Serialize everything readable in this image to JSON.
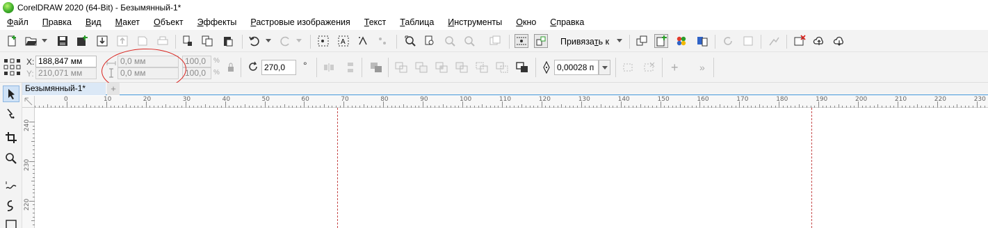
{
  "window": {
    "title": "CorelDRAW 2020 (64-Bit) - Безымянный-1*"
  },
  "menu": [
    {
      "u": "Ф",
      "rest": "айл"
    },
    {
      "u": "П",
      "rest": "равка"
    },
    {
      "u": "В",
      "rest": "ид"
    },
    {
      "u": "М",
      "rest": "акет"
    },
    {
      "u": "О",
      "rest": "бъект"
    },
    {
      "u": "Э",
      "rest": "ффекты"
    },
    {
      "u": "Р",
      "rest": "астровые изображения"
    },
    {
      "u": "Т",
      "rest": "екст"
    },
    {
      "u": "Т",
      "rest": "аблица"
    },
    {
      "u": "И",
      "rest": "нструменты"
    },
    {
      "u": "О",
      "rest": "кно"
    },
    {
      "u": "С",
      "rest": "правка"
    }
  ],
  "toolbar": {
    "snap_label_pre": "Привяза",
    "snap_label_u": "т",
    "snap_label_post": "ь к",
    "icons": [
      "new-document-icon",
      "open-folder-icon",
      "save-icon",
      "new-from-template-icon",
      "import-icon",
      "export-icon",
      "publish-pdf-icon",
      "print-icon",
      "cut-icon",
      "copy-icon",
      "paste-icon",
      "undo-icon",
      "redo-icon",
      "search-content-icon",
      "quick-text-icon",
      "spell-icon",
      "zoom-to-fit-icon",
      "zoom-level-icon",
      "full-screen-icon",
      "show-rulers-icon",
      "show-grid-icon",
      "snap-icon",
      "options-icon",
      "colors-icon",
      "document-properties-icon",
      "launch-icon",
      "upload-cloud-icon",
      "download-cloud-icon"
    ]
  },
  "propbar": {
    "x_label": "X:",
    "y_label": "Y:",
    "x_value": "188,847 мм",
    "y_value": "210,071 мм",
    "width_value": "0,0 мм",
    "height_value": "0,0 мм",
    "scale_x": "100,0",
    "scale_y": "100,0",
    "scale_unit": "%",
    "rotation_value": "270,0",
    "rotation_unit": "°",
    "outline_value": "0,00028 п"
  },
  "document": {
    "tab_label": "Безымянный-1*",
    "add_tab_label": "+"
  },
  "ruler": {
    "h_labels": [
      "0",
      "10",
      "20",
      "30",
      "40",
      "50",
      "60",
      "70",
      "80",
      "90",
      "100",
      "110",
      "120",
      "130",
      "140",
      "150",
      "160",
      "170",
      "180",
      "190",
      "200",
      "210",
      "220",
      "230"
    ],
    "v_labels": [
      "240",
      "230",
      "220"
    ]
  },
  "toolbox": [
    "pick-tool-icon",
    "shape-tool-icon",
    "crop-tool-icon",
    "zoom-tool-icon",
    "freehand-tool-icon",
    "artistic-media-tool-icon",
    "rectangle-tool-icon"
  ],
  "colors": {
    "annotation": "#d9231e",
    "page_border": "#c64a4a",
    "tab_active": "#dbe8f6",
    "accent": "#3d93d8"
  }
}
